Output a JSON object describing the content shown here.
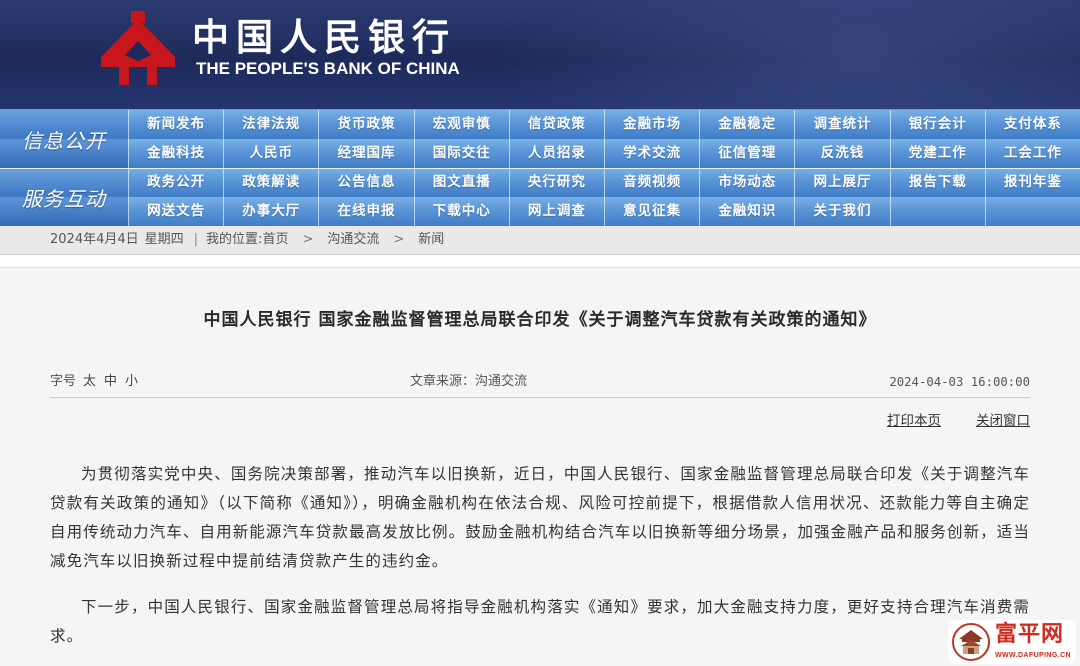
{
  "header": {
    "logo_icon": "pboc-emblem-icon",
    "title_cn": "中国人民银行",
    "title_en": "THE PEOPLE'S BANK OF CHINA"
  },
  "nav": {
    "groups": [
      {
        "label": "信息公开",
        "rows": [
          [
            "新闻发布",
            "法律法规",
            "货币政策",
            "宏观审慎",
            "信贷政策",
            "金融市场",
            "金融稳定",
            "调查统计",
            "银行会计",
            "支付体系"
          ],
          [
            "金融科技",
            "人民币",
            "经理国库",
            "国际交往",
            "人员招录",
            "学术交流",
            "征信管理",
            "反洗钱",
            "党建工作",
            "工会工作"
          ]
        ]
      },
      {
        "label": "服务互动",
        "rows": [
          [
            "政务公开",
            "政策解读",
            "公告信息",
            "图文直播",
            "央行研究",
            "音频视频",
            "市场动态",
            "网上展厅",
            "报告下载",
            "报刊年鉴"
          ],
          [
            "网送文告",
            "办事大厅",
            "在线申报",
            "下载中心",
            "网上调查",
            "意见征集",
            "金融知识",
            "关于我们"
          ]
        ]
      }
    ]
  },
  "breadcrumb": {
    "date": "2024年4月4日",
    "weekday": "星期四",
    "divider": "|",
    "location_label": "我的位置:",
    "items": [
      "首页",
      "沟通交流",
      "新闻"
    ],
    "separator": ">"
  },
  "article": {
    "title": "中国人民银行 国家金融监督管理总局联合印发《关于调整汽车贷款有关政策的通知》",
    "font_size_label": "字号",
    "font_sizes": [
      "太",
      "中",
      "小"
    ],
    "source": "文章来源：沟通交流",
    "datetime": "2024-04-03 16:00:00",
    "actions": {
      "print": "打印本页",
      "close": "关闭窗口"
    },
    "paragraphs": [
      "为贯彻落实党中央、国务院决策部署，推动汽车以旧换新，近日，中国人民银行、国家金融监督管理总局联合印发《关于调整汽车贷款有关政策的通知》（以下简称《通知》），明确金融机构在依法合规、风险可控前提下，根据借款人信用状况、还款能力等自主确定自用传统动力汽车、自用新能源汽车贷款最高发放比例。鼓励金融机构结合汽车以旧换新等细分场景，加强金融产品和服务创新，适当减免汽车以旧换新过程中提前结清贷款产生的违约金。",
      "下一步，中国人民银行、国家金融监督管理总局将指导金融机构落实《通知》要求，加大金融支持力度，更好支持合理汽车消费需求。"
    ]
  },
  "watermark": {
    "icon": "pavilion-icon",
    "name": "富平网",
    "url": "WWW.DAFUPING.CN"
  },
  "colors": {
    "header_navy": "#1d2a5a",
    "nav_blue": "#3f7dc7",
    "nav_blue_light": "#79b0e6",
    "emblem_red": "#c8161d",
    "watermark_red": "#d12b1f",
    "body_text": "#333333"
  }
}
